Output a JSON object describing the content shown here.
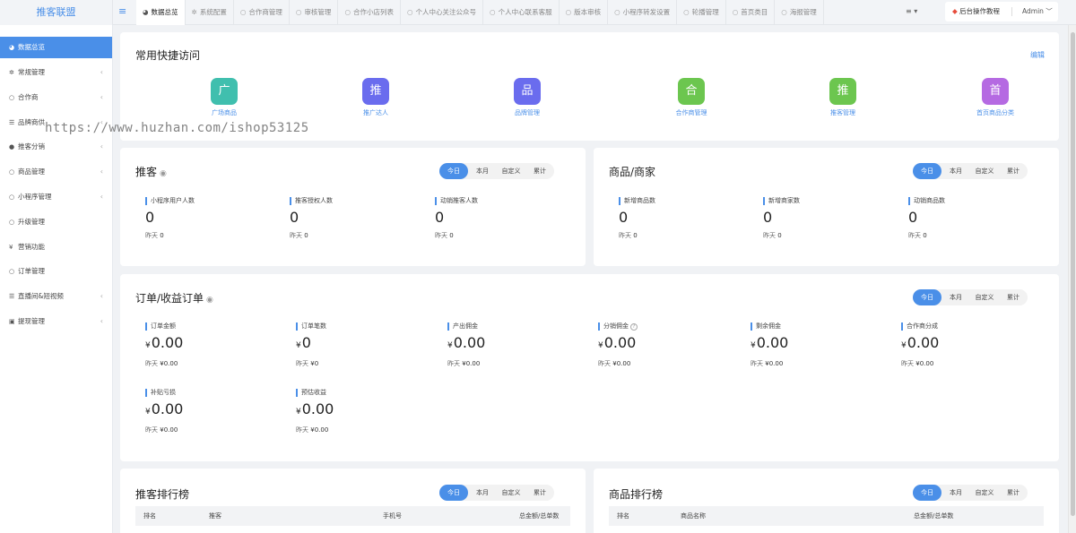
{
  "header": {
    "logo": "推客联盟",
    "menu_icon": "≡",
    "more_icon": "≡",
    "tutorial_label": "后台操作教程",
    "admin_label": "Admin ﹀",
    "tabs": [
      {
        "label": "数据总览",
        "icon": "◕"
      },
      {
        "label": "系统配置",
        "icon": "✲"
      },
      {
        "label": "合作商管理",
        "icon": "○"
      },
      {
        "label": "审核管理",
        "icon": "○"
      },
      {
        "label": "合作小店列表",
        "icon": "○"
      },
      {
        "label": "个人中心关注公众号",
        "icon": "○"
      },
      {
        "label": "个人中心联系客服",
        "icon": "○"
      },
      {
        "label": "版本审核",
        "icon": "○"
      },
      {
        "label": "小程序转发设置",
        "icon": "○"
      },
      {
        "label": "轮播管理",
        "icon": "○"
      },
      {
        "label": "首页类目",
        "icon": "○"
      },
      {
        "label": "海报管理",
        "icon": "○"
      }
    ]
  },
  "sidebar": {
    "items": [
      {
        "label": "数据总览",
        "icon": "◕"
      },
      {
        "label": "常规管理",
        "icon": "✲"
      },
      {
        "label": "合作商",
        "icon": "○"
      },
      {
        "label": "品牌商供",
        "icon": "☰"
      },
      {
        "label": "推客分销",
        "icon": "●"
      },
      {
        "label": "商品管理",
        "icon": "○"
      },
      {
        "label": "小程序管理",
        "icon": "○"
      },
      {
        "label": "升级管理",
        "icon": "○"
      },
      {
        "label": "营销功能",
        "icon": "¥"
      },
      {
        "label": "订单管理",
        "icon": "○"
      },
      {
        "label": "直播间&短视频",
        "icon": "☰"
      },
      {
        "label": "提现管理",
        "icon": "▣"
      }
    ]
  },
  "quick": {
    "title": "常用快捷访问",
    "edit": "编辑",
    "items": [
      {
        "char": "广",
        "label": "广场商品",
        "color": "#40bfae"
      },
      {
        "char": "推",
        "label": "推广达人",
        "color": "#6a6cee"
      },
      {
        "char": "品",
        "label": "品牌管理",
        "color": "#6a6cee"
      },
      {
        "char": "合",
        "label": "合作商管理",
        "color": "#6cc64f"
      },
      {
        "char": "推",
        "label": "推客管理",
        "color": "#6cc64f"
      },
      {
        "char": "首",
        "label": "首页商品分类",
        "color": "#b56ae2"
      }
    ]
  },
  "segments": [
    "今日",
    "本月",
    "自定义",
    "累计"
  ],
  "tuike": {
    "title": "推客",
    "eye": "◉",
    "stats": [
      {
        "label": "小程序用户人数",
        "value": "0",
        "yest": "昨天",
        "yval": "0"
      },
      {
        "label": "推客授权人数",
        "value": "0",
        "yest": "昨天",
        "yval": "0"
      },
      {
        "label": "动销推客人数",
        "value": "0",
        "yest": "昨天",
        "yval": "0"
      }
    ]
  },
  "goods": {
    "title": "商品/商家",
    "stats": [
      {
        "label": "新增商品数",
        "value": "0",
        "yest": "昨天",
        "yval": "0"
      },
      {
        "label": "新增商家数",
        "value": "0",
        "yest": "昨天",
        "yval": "0"
      },
      {
        "label": "动销商品数",
        "value": "0",
        "yest": "昨天",
        "yval": "0"
      }
    ]
  },
  "orders": {
    "title": "订单/收益订单",
    "eye": "◉",
    "currency": "¥",
    "help": "?",
    "stats": [
      {
        "label": "订单金额",
        "value": "0.00",
        "yest": "昨天",
        "yval": "¥0.00"
      },
      {
        "label": "订单笔数",
        "value": "0",
        "yest": "昨天",
        "yval": "¥0"
      },
      {
        "label": "产出佣金",
        "value": "0.00",
        "yest": "昨天",
        "yval": "¥0.00"
      },
      {
        "label": "分销佣金",
        "value": "0.00",
        "yest": "昨天",
        "yval": "¥0.00"
      },
      {
        "label": "剩余佣金",
        "value": "0.00",
        "yest": "昨天",
        "yval": "¥0.00"
      },
      {
        "label": "合作商分成",
        "value": "0.00",
        "yest": "昨天",
        "yval": "¥0.00"
      },
      {
        "label": "补贴亏损",
        "value": "0.00",
        "yest": "昨天",
        "yval": "¥0.00"
      },
      {
        "label": "预估收益",
        "value": "0.00",
        "yest": "昨天",
        "yval": "¥0.00"
      }
    ]
  },
  "rank_tuike": {
    "title": "推客排行榜",
    "cols": [
      "排名",
      "推客",
      "手机号",
      "总金额/总单数"
    ]
  },
  "rank_goods": {
    "title": "商品排行榜",
    "cols": [
      "排名",
      "商品名称",
      "总金额/总单数"
    ]
  },
  "watermark": "https://www.huzhan.com/ishop53125"
}
